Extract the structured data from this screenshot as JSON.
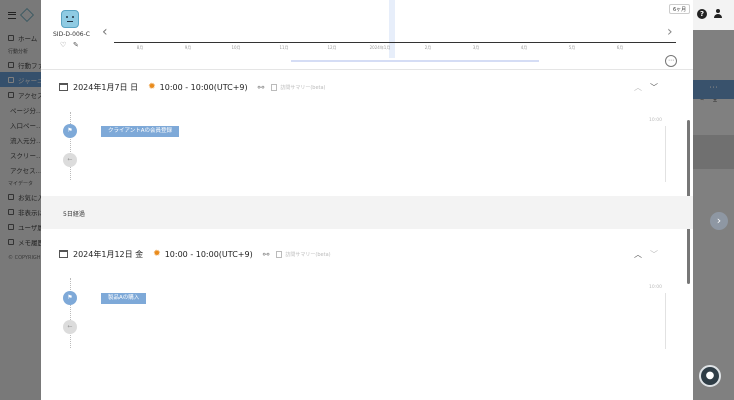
{
  "sidebar": {
    "items": [
      {
        "label": "ホーム"
      },
      {
        "label": "行動ファ…"
      },
      {
        "label": "ジャーニ…"
      },
      {
        "label": "アクセス…"
      },
      {
        "label": "ページ分…"
      },
      {
        "label": "入口ペー…"
      },
      {
        "label": "流入元分…"
      },
      {
        "label": "スクリー…"
      },
      {
        "label": "アクセス…"
      },
      {
        "label": "お気に入…"
      },
      {
        "label": "非表示に…"
      },
      {
        "label": "ユーザ属…"
      },
      {
        "label": "メモ履歴"
      }
    ],
    "section_analysis": "行動分析",
    "section_mydata": "マイデータ",
    "copyright": "© COPYRIGH…"
  },
  "header": {
    "session_id": "SID-D-006-C",
    "range_label": "6ヶ月",
    "ticks": [
      "8月",
      "9月",
      "10月",
      "11月",
      "12月",
      "2024年1月",
      "2月",
      "3月",
      "4月",
      "5月",
      "6月"
    ]
  },
  "days": [
    {
      "date": "2024年1月7日 日",
      "time": "10:00 - 10:00(UTC+9)",
      "summary": "訪問サマリー(beta)",
      "event_label": "クライアントAの会員登録",
      "event_time": "10:00"
    },
    {
      "date": "2024年1月12日 金",
      "time": "10:00 - 10:00(UTC+9)",
      "summary": "訪問サマリー(beta)",
      "event_label": "製品Aの購入",
      "event_time": "10:00"
    }
  ],
  "gap_label": "5日経過",
  "icons": {
    "more": "⋯",
    "help": "?",
    "next": "›",
    "prev": "‹",
    "edit": "✎",
    "download": "⤓",
    "flag": "⚑",
    "back": "←",
    "sun": "✹",
    "link": "🔗",
    "bulb": "●"
  }
}
